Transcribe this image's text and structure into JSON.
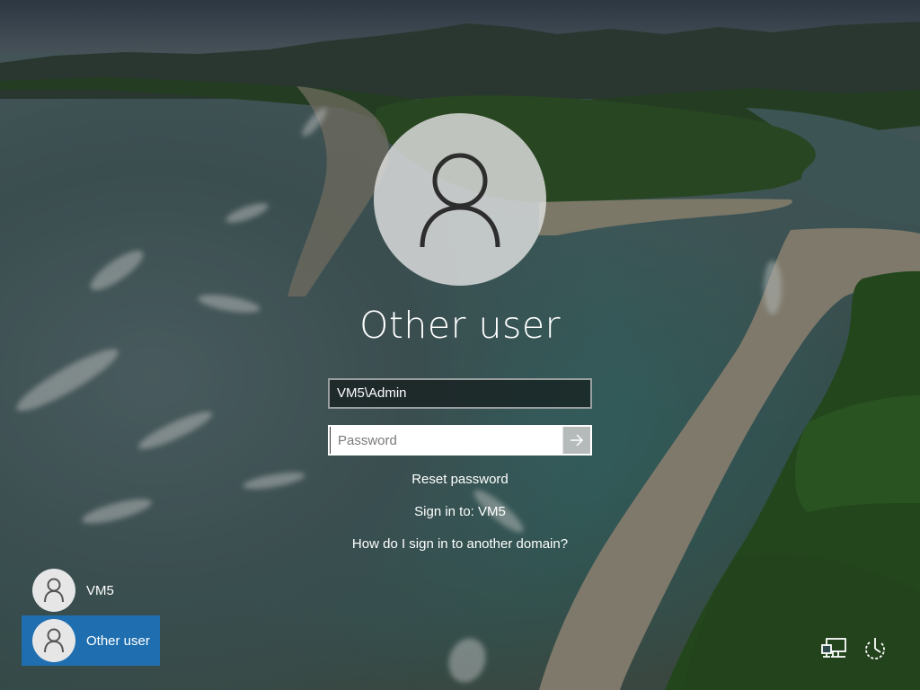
{
  "login": {
    "user_title": "Other user",
    "username_value": "VM5\\Admin",
    "password_placeholder": "Password",
    "reset_password": "Reset password",
    "sign_in_to": "Sign in to: VM5",
    "domain_help": "How do I sign in to another domain?"
  },
  "users": [
    {
      "label": "VM5",
      "selected": false
    },
    {
      "label": "Other user",
      "selected": true
    }
  ],
  "corner_icons": [
    "network-icon",
    "power-icon"
  ],
  "colors": {
    "selected_tile": "#1f6fb0",
    "avatar_bg": "#e1e1e1",
    "text": "#ffffff"
  }
}
